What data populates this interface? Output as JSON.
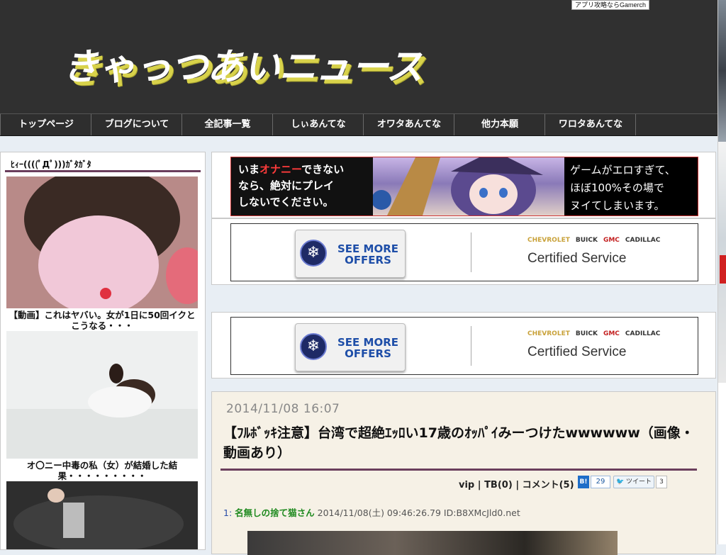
{
  "header": {
    "gamerch_link": "アプリ攻略ならGamerch",
    "site_title": "きゃっつあいニュース"
  },
  "nav": {
    "items": [
      "トップページ",
      "ブログについて",
      "全記事一覧",
      "しぃあんてな",
      "オワタあんてな",
      "他力本願",
      "ワロタあんてな"
    ]
  },
  "sidebar": {
    "title": "ﾋｨｰ((((ﾟДﾟ)))ｶﾞﾀｶﾞﾀ",
    "articles": [
      {
        "caption": "【動画】これはヤバい。女が1日に50回イクとこうなる・・・"
      },
      {
        "caption": "オ〇ニー中毒の私（女）が結婚した結果・・・・・・・・・"
      },
      {
        "caption": ""
      }
    ]
  },
  "ads": {
    "game_banner": {
      "left_line1_pre": "いま",
      "left_line1_hl": "オナニー",
      "left_line1_post": "できない",
      "left_line2": "なら、絶対にプレイ",
      "left_line3": "しないでください。",
      "right_line1": "ゲームがエロすぎて、",
      "right_line2": "ほぼ100%その場で",
      "right_line3": "ヌイてしまいます。"
    },
    "offer_banner": {
      "button_line1": "SEE MORE",
      "button_line2": "OFFERS",
      "brands": [
        "CHEVROLET",
        "BUICK",
        "GMC",
        "CADILLAC"
      ],
      "certified": "Certified Service"
    }
  },
  "article": {
    "date": "2014/11/08 16:07",
    "title": "【ﾌﾙﾎﾞｯｷ注意】台湾で超絶ｴｯﾛい17歳のｵｯﾊﾟｲみーつけたwwwwww（画像・動画あり）",
    "category": "vip",
    "tb": "TB(0)",
    "comments": "コメント(5)",
    "hatebu_icon": "B!",
    "hatebu_count": "29",
    "tweet_label": "ツイート",
    "tweet_count": "3",
    "first_comment": {
      "num": "1:",
      "name": "名無しの捨て猫さん",
      "info": "2014/11/08(土) 09:46:26.79 ID:B8XMcJld0.net"
    }
  },
  "colors": {
    "header_bg": "#303030",
    "accent_purple": "#6a3e5c",
    "logo_shadow": "#d8d24a",
    "article_bg": "#f6f1e6"
  }
}
